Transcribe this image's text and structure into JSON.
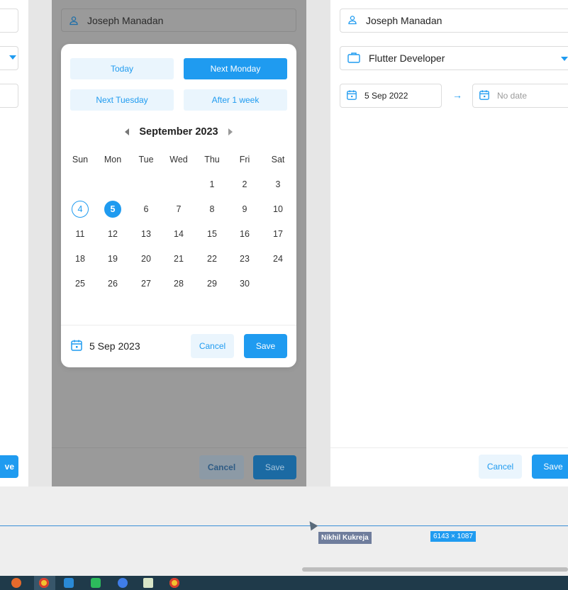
{
  "middle_frame": {
    "name_field": "Joseph Manadan",
    "footer_cancel": "Cancel",
    "footer_save": "Save"
  },
  "date_picker": {
    "quick_buttons": [
      "Today",
      "Next Monday",
      "Next Tuesday",
      "After 1 week"
    ],
    "active_quick_button": "Next Monday",
    "month_label": "September 2023",
    "weekdays": [
      "Sun",
      "Mon",
      "Tue",
      "Wed",
      "Thu",
      "Fri",
      "Sat"
    ],
    "days": [
      [
        "",
        "",
        "",
        "",
        "1",
        "2",
        "3"
      ],
      [
        "4",
        "5",
        "6",
        "7",
        "8",
        "9",
        "10"
      ],
      [
        "11",
        "12",
        "13",
        "14",
        "15",
        "16",
        "17"
      ],
      [
        "18",
        "19",
        "20",
        "21",
        "22",
        "23",
        "24"
      ],
      [
        "25",
        "26",
        "27",
        "28",
        "29",
        "30",
        ""
      ]
    ],
    "today_day": "4",
    "selected_day": "5",
    "selected_date": "5 Sep 2023",
    "cancel_label": "Cancel",
    "save_label": "Save"
  },
  "right_frame": {
    "name_field": "Joseph Manadan",
    "role_field": "Flutter Developer",
    "start_date": "5 Sep 2022",
    "end_date_placeholder": "No date",
    "cancel_label": "Cancel",
    "save_label": "Save"
  },
  "left_frame": {
    "save_label_partial": "ve"
  },
  "canvas": {
    "collaborator_name": "Nikhil Kukreja",
    "frame_dimensions": "6143 × 1087"
  },
  "colors": {
    "accent": "#1f9bf0",
    "accent_light": "#eaf5fd",
    "overlay": "#9a9a9a",
    "taskbar": "#1f3a4a"
  }
}
